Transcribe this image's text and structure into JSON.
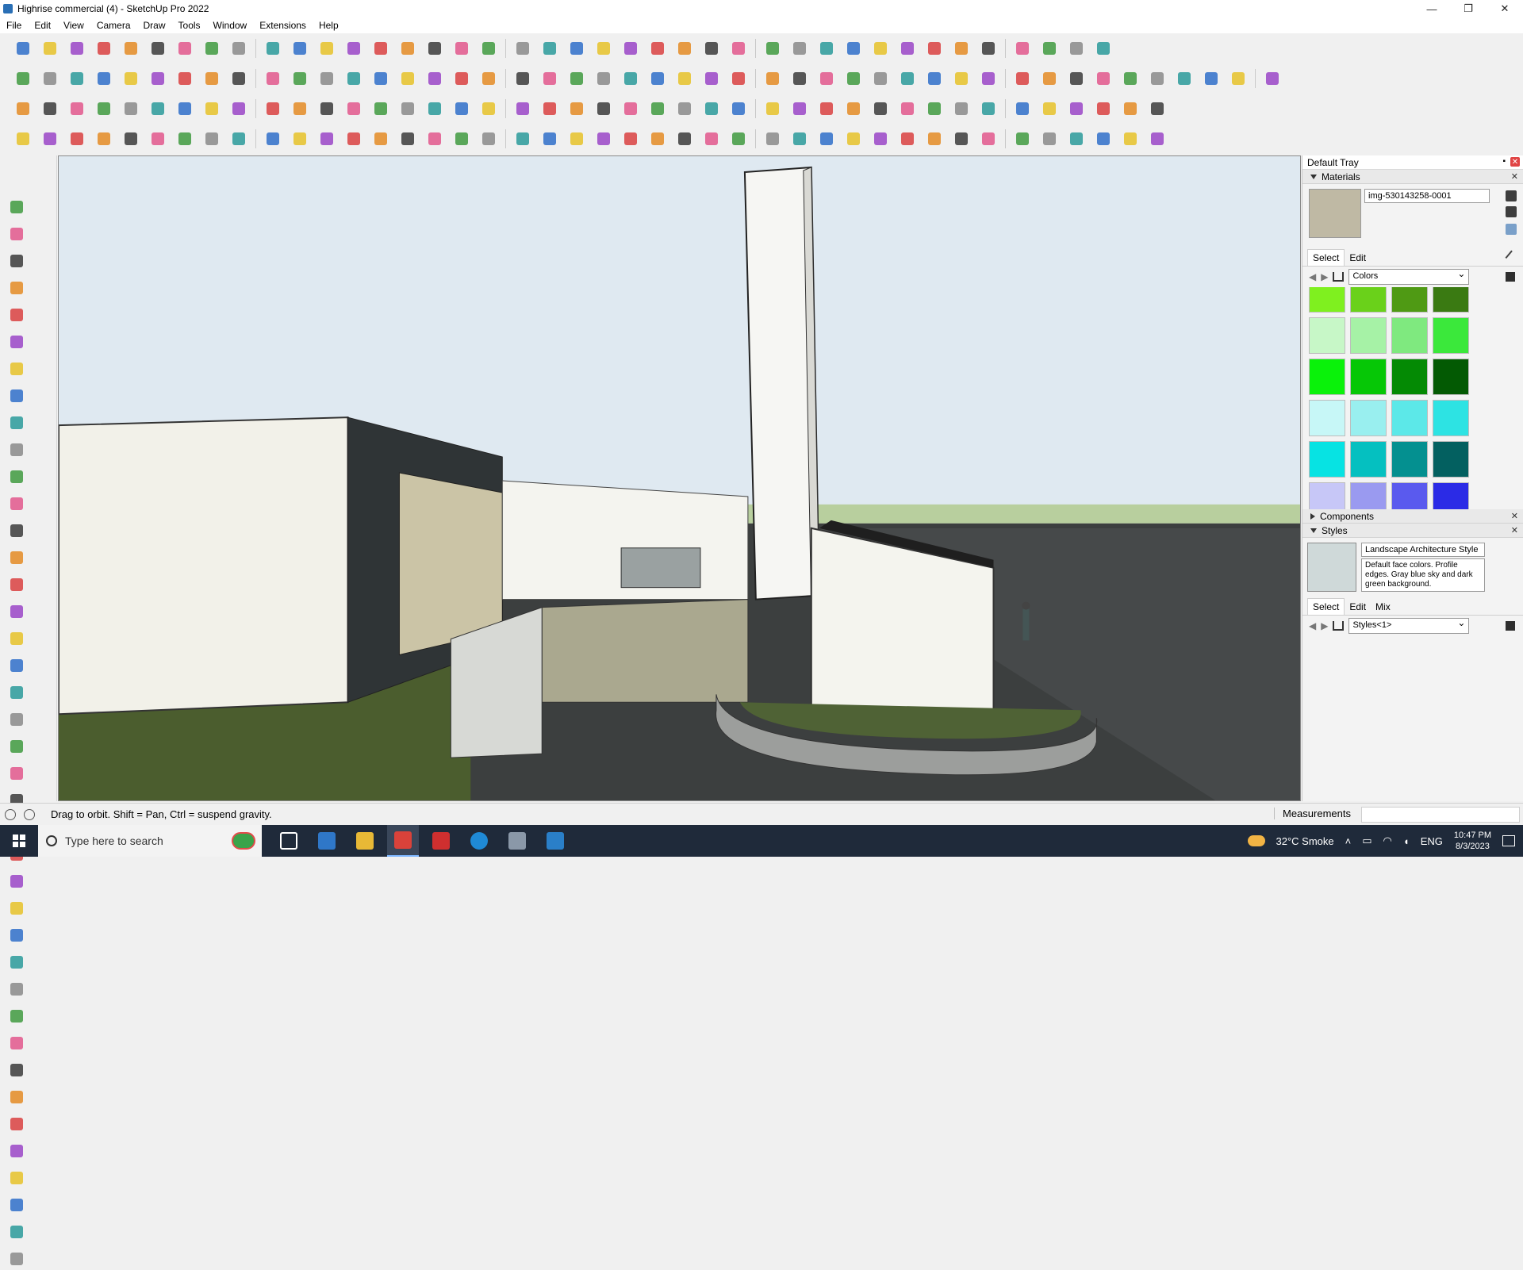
{
  "window": {
    "title": "Highrise commercial (4) - SketchUp Pro 2022",
    "controls": [
      "—",
      "❐",
      "✕"
    ]
  },
  "menu": [
    "File",
    "Edit",
    "View",
    "Camera",
    "Draw",
    "Tools",
    "Window",
    "Extensions",
    "Help"
  ],
  "tray": {
    "title": "Default Tray",
    "materials": {
      "title": "Materials",
      "name": "img-530143258-0001",
      "tabs": [
        "Select",
        "Edit"
      ],
      "library": "Colors",
      "swatch_color": "#bfb9a4",
      "swatches": [
        [
          "#7ff01f",
          "#6ad11a",
          "#4f9a14",
          "#3a7a12"
        ],
        [
          "#c7f7c7",
          "#a6f2a6",
          "#7fe97f",
          "#3be83b"
        ],
        [
          "#0af20a",
          "#06c706",
          "#048a04",
          "#035a03"
        ],
        [
          "#c7f7f7",
          "#99efef",
          "#5ce8e8",
          "#2de3e3"
        ],
        [
          "#07e3e3",
          "#05c0c0",
          "#049090",
          "#036060"
        ],
        [
          "#c7c7f7",
          "#9a9af0",
          "#5a5aee",
          "#2b2be6"
        ]
      ]
    },
    "components": {
      "title": "Components"
    },
    "styles": {
      "title": "Styles",
      "name": "Landscape Architecture Style",
      "description": "Default face colors. Profile edges. Gray blue sky and dark green background.",
      "tabs": [
        "Select",
        "Edit",
        "Mix"
      ],
      "library": "Styles<1>"
    }
  },
  "status": {
    "hint": "Drag to orbit. Shift = Pan, Ctrl = suspend gravity.",
    "measurements_label": "Measurements",
    "measurements_value": ""
  },
  "taskbar": {
    "search_placeholder": "Type here to search",
    "weather": "32°C  Smoke",
    "lang": "ENG",
    "time": "10:47 PM",
    "date": "8/3/2023"
  },
  "icons": {
    "toolbar_colors": [
      "red",
      "blue",
      "green",
      "orange",
      "yellow",
      "gray",
      "dark",
      "purple",
      "teal",
      "pink"
    ]
  }
}
